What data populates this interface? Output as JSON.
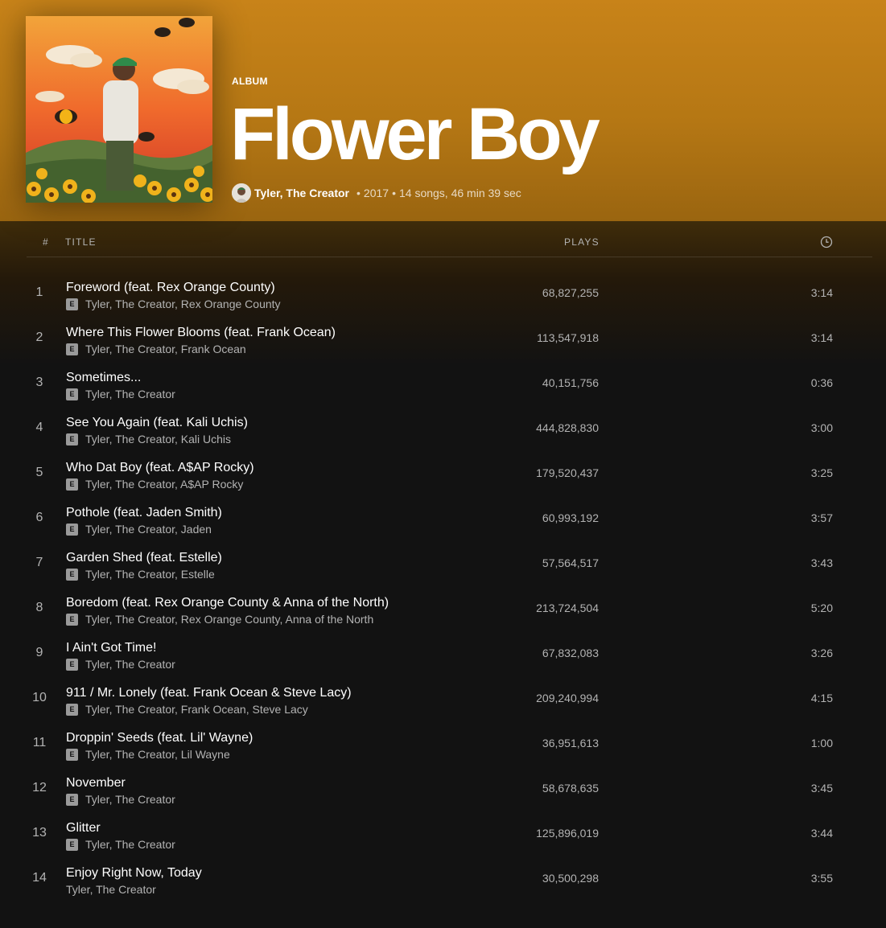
{
  "album": {
    "type": "ALBUM",
    "title": "Flower Boy",
    "artist": "Tyler, The Creator",
    "year": "2017",
    "summary": "14 songs, 46 min 39 sec",
    "gradient_top": "#c88319"
  },
  "columns": {
    "num": "#",
    "title": "TITLE",
    "plays": "PLAYS",
    "duration_icon": "clock-icon"
  },
  "tracks": [
    {
      "num": "1",
      "title": "Foreword (feat. Rex Orange County)",
      "artists": "Tyler, The Creator, Rex Orange County",
      "explicit": true,
      "plays": "68,827,255",
      "duration": "3:14"
    },
    {
      "num": "2",
      "title": "Where This Flower Blooms (feat. Frank Ocean)",
      "artists": "Tyler, The Creator, Frank Ocean",
      "explicit": true,
      "plays": "113,547,918",
      "duration": "3:14"
    },
    {
      "num": "3",
      "title": "Sometimes...",
      "artists": "Tyler, The Creator",
      "explicit": true,
      "plays": "40,151,756",
      "duration": "0:36"
    },
    {
      "num": "4",
      "title": "See You Again (feat. Kali Uchis)",
      "artists": "Tyler, The Creator, Kali Uchis",
      "explicit": true,
      "plays": "444,828,830",
      "duration": "3:00"
    },
    {
      "num": "5",
      "title": "Who Dat Boy (feat. A$AP Rocky)",
      "artists": "Tyler, The Creator, A$AP Rocky",
      "explicit": true,
      "plays": "179,520,437",
      "duration": "3:25"
    },
    {
      "num": "6",
      "title": "Pothole (feat. Jaden Smith)",
      "artists": "Tyler, The Creator, Jaden",
      "explicit": true,
      "plays": "60,993,192",
      "duration": "3:57"
    },
    {
      "num": "7",
      "title": "Garden Shed (feat. Estelle)",
      "artists": "Tyler, The Creator, Estelle",
      "explicit": true,
      "plays": "57,564,517",
      "duration": "3:43"
    },
    {
      "num": "8",
      "title": "Boredom (feat. Rex Orange County & Anna of the North)",
      "artists": "Tyler, The Creator, Rex Orange County, Anna of the North",
      "explicit": true,
      "plays": "213,724,504",
      "duration": "5:20"
    },
    {
      "num": "9",
      "title": "I Ain't Got Time!",
      "artists": "Tyler, The Creator",
      "explicit": true,
      "plays": "67,832,083",
      "duration": "3:26"
    },
    {
      "num": "10",
      "title": "911 / Mr. Lonely (feat. Frank Ocean & Steve Lacy)",
      "artists": "Tyler, The Creator, Frank Ocean, Steve Lacy",
      "explicit": true,
      "plays": "209,240,994",
      "duration": "4:15"
    },
    {
      "num": "11",
      "title": "Droppin' Seeds (feat. Lil' Wayne)",
      "artists": "Tyler, The Creator, Lil Wayne",
      "explicit": true,
      "plays": "36,951,613",
      "duration": "1:00"
    },
    {
      "num": "12",
      "title": "November",
      "artists": "Tyler, The Creator",
      "explicit": true,
      "plays": "58,678,635",
      "duration": "3:45"
    },
    {
      "num": "13",
      "title": "Glitter",
      "artists": "Tyler, The Creator",
      "explicit": true,
      "plays": "125,896,019",
      "duration": "3:44"
    },
    {
      "num": "14",
      "title": "Enjoy Right Now, Today",
      "artists": "Tyler, The Creator",
      "explicit": false,
      "plays": "30,500,298",
      "duration": "3:55"
    }
  ],
  "explicit_badge": "E"
}
